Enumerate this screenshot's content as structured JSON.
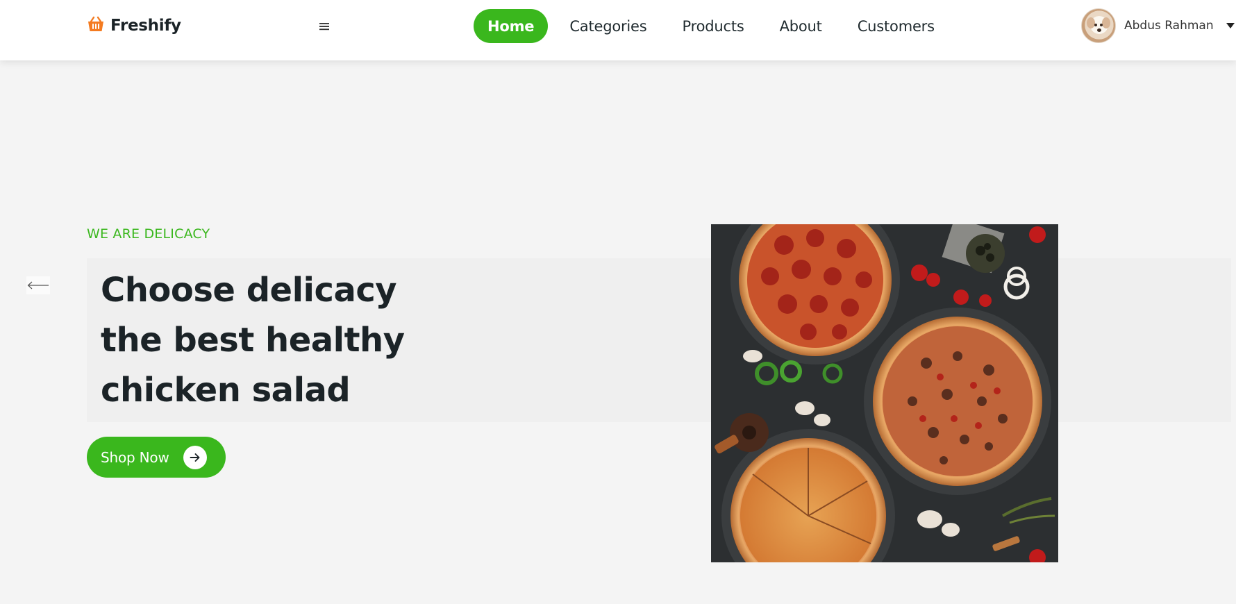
{
  "brand": {
    "name": "Freshify",
    "icon": "shopping-basket-icon",
    "icon_color": "#f47b20"
  },
  "nav": {
    "items": [
      {
        "label": "Home",
        "active": true
      },
      {
        "label": "Categories",
        "active": false
      },
      {
        "label": "Products",
        "active": false
      },
      {
        "label": "About",
        "active": false
      },
      {
        "label": "Customers",
        "active": false
      }
    ],
    "menu_icon": "hamburger-menu-icon"
  },
  "user": {
    "name": "Abdus Rahman",
    "avatar_icon": "dog-avatar",
    "dropdown_icon": "caret-down-icon"
  },
  "hero": {
    "eyebrow": "WE ARE DELICACY",
    "headline_lines": [
      "Choose delicacy",
      "the best healthy",
      "chicken salad"
    ],
    "cta_label": "Shop Now",
    "cta_icon": "arrow-right-icon",
    "prev_icon": "arrow-left-icon",
    "image": "pizza-spread-photo"
  },
  "colors": {
    "accent": "#3ab71d",
    "text": "#1b2327",
    "background": "#f4f4f4"
  }
}
